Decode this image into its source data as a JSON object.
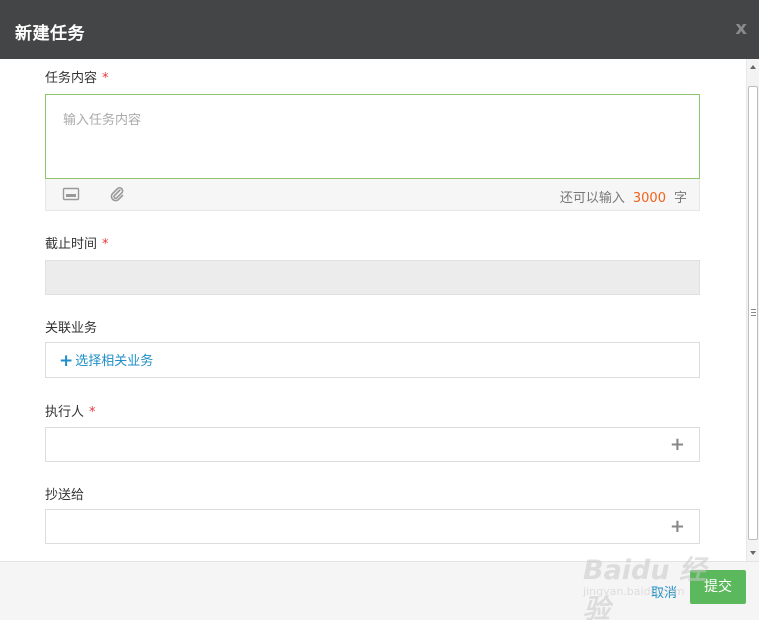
{
  "dialog": {
    "title": "新建任务",
    "close_label": "x"
  },
  "form": {
    "content": {
      "label": "任务内容",
      "required_mark": "*",
      "placeholder": "输入任务内容",
      "counter_prefix": "还可以输入",
      "counter_value": "3000",
      "counter_suffix": "字",
      "toolbar_icons": [
        "image-icon",
        "paperclip-icon"
      ]
    },
    "deadline": {
      "label": "截止时间",
      "required_mark": "*",
      "value": ""
    },
    "related_business": {
      "label": "关联业务",
      "link_plus": "+",
      "link_text": "选择相关业务"
    },
    "assignee": {
      "label": "执行人",
      "required_mark": "*",
      "add_symbol": "+"
    },
    "cc": {
      "label": "抄送给",
      "add_symbol": "+"
    }
  },
  "footer": {
    "cancel_label": "取消",
    "submit_label": "提交"
  },
  "watermark": {
    "text": "Baidu 经验",
    "sub": "jingyan.baidu.com"
  },
  "colors": {
    "header_bg": "#444546",
    "accent_link": "#1e8fc7",
    "required": "#e4393c",
    "counter_number": "#f3621c",
    "submit_bg": "#5cb85c",
    "focus_border": "#8fc46a"
  }
}
